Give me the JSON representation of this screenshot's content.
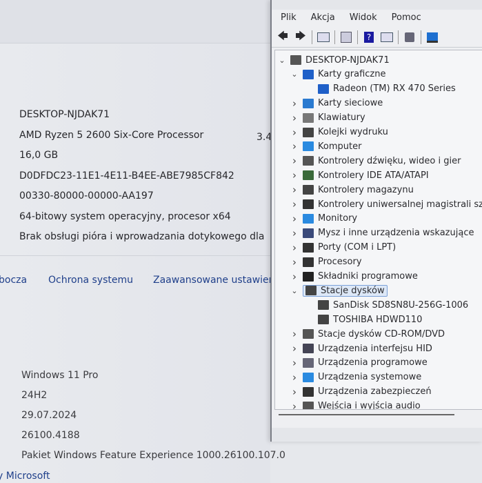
{
  "system_info": {
    "specs": [
      "DESKTOP-NJDAK71",
      "AMD Ryzen 5 2600 Six-Core Processor",
      "16,0 GB",
      "D0DFDC23-11E1-4E11-B4EE-ABE7985CF842",
      "00330-80000-00000-AA197",
      "64-bitowy system operacyjny, procesor x64",
      "Brak obsługi pióra i wprowadzania dotykowego dla"
    ],
    "cpu_freq": "3.4",
    "links": [
      "bocza",
      "Ochrona systemu",
      "Zaawansowane ustawier"
    ],
    "windows_specs": [
      "Windows 11 Pro",
      "24H2",
      "29.07.2024",
      "26100.4188",
      "Pakiet Windows Feature Experience 1000.26100.107.0"
    ],
    "ms_link": "y Microsoft"
  },
  "device_manager": {
    "menu": [
      "Plik",
      "Akcja",
      "Widok",
      "Pomoc"
    ],
    "toolbar_icons": [
      "back-arrow-icon",
      "forward-arrow-icon",
      "properties-icon",
      "driver-icon",
      "help-icon",
      "view-icon",
      "scan-hardware-icon",
      "monitor-icon"
    ],
    "tree": [
      {
        "label": "DESKTOP-NJDAK71",
        "level": 0,
        "expanded": true,
        "icon": "computer-tower-icon",
        "color": "#555"
      },
      {
        "label": "Karty graficzne",
        "level": 1,
        "expanded": true,
        "icon": "display-adapter-icon",
        "color": "#1e5fc8"
      },
      {
        "label": "Radeon (TM) RX 470 Series",
        "level": 2,
        "icon": "display-adapter-icon",
        "color": "#1e5fc8"
      },
      {
        "label": "Karty sieciowe",
        "level": 1,
        "expanded": false,
        "icon": "network-icon",
        "color": "#2a7ad0"
      },
      {
        "label": "Klawiatury",
        "level": 1,
        "expanded": false,
        "icon": "keyboard-icon",
        "color": "#777"
      },
      {
        "label": "Kolejki wydruku",
        "level": 1,
        "expanded": false,
        "icon": "printer-icon",
        "color": "#444"
      },
      {
        "label": "Komputer",
        "level": 1,
        "expanded": false,
        "icon": "monitor-icon",
        "color": "#2a8ae0"
      },
      {
        "label": "Kontrolery dźwięku, wideo i gier",
        "level": 1,
        "expanded": false,
        "icon": "speaker-icon",
        "color": "#555"
      },
      {
        "label": "Kontrolery IDE ATA/ATAPI",
        "level": 1,
        "expanded": false,
        "icon": "ide-controller-icon",
        "color": "#3a6a3a"
      },
      {
        "label": "Kontrolery magazynu",
        "level": 1,
        "expanded": false,
        "icon": "storage-controller-icon",
        "color": "#444"
      },
      {
        "label": "Kontrolery uniwersalnej magistrali szere",
        "level": 1,
        "expanded": false,
        "icon": "usb-icon",
        "color": "#333"
      },
      {
        "label": "Monitory",
        "level": 1,
        "expanded": false,
        "icon": "monitor-icon",
        "color": "#2a8ae0"
      },
      {
        "label": "Mysz i inne urządzenia wskazujące",
        "level": 1,
        "expanded": false,
        "icon": "mouse-icon",
        "color": "#3a4a7a"
      },
      {
        "label": "Porty (COM i LPT)",
        "level": 1,
        "expanded": false,
        "icon": "port-icon",
        "color": "#333"
      },
      {
        "label": "Procesory",
        "level": 1,
        "expanded": false,
        "icon": "processor-icon",
        "color": "#333"
      },
      {
        "label": "Składniki programowe",
        "level": 1,
        "expanded": false,
        "icon": "software-component-icon",
        "color": "#222"
      },
      {
        "label": "Stacje dysków",
        "level": 1,
        "expanded": true,
        "selected": true,
        "icon": "disk-drive-icon",
        "color": "#444"
      },
      {
        "label": "SanDisk SD8SN8U-256G-1006",
        "level": 2,
        "icon": "disk-drive-icon",
        "color": "#444"
      },
      {
        "label": "TOSHIBA HDWD110",
        "level": 2,
        "icon": "disk-drive-icon",
        "color": "#444"
      },
      {
        "label": "Stacje dysków CD-ROM/DVD",
        "level": 1,
        "expanded": false,
        "icon": "cdrom-icon",
        "color": "#555"
      },
      {
        "label": "Urządzenia interfejsu HID",
        "level": 1,
        "expanded": false,
        "icon": "hid-icon",
        "color": "#445"
      },
      {
        "label": "Urządzenia programowe",
        "level": 1,
        "expanded": false,
        "icon": "software-device-icon",
        "color": "#667"
      },
      {
        "label": "Urządzenia systemowe",
        "level": 1,
        "expanded": false,
        "icon": "system-device-icon",
        "color": "#2a8ae0"
      },
      {
        "label": "Urządzenia zabezpieczeń",
        "level": 1,
        "expanded": false,
        "icon": "security-device-icon",
        "color": "#333"
      },
      {
        "label": "Wejścia i wyjścia audio",
        "level": 1,
        "expanded": false,
        "icon": "audio-io-icon",
        "color": "#555"
      }
    ]
  }
}
